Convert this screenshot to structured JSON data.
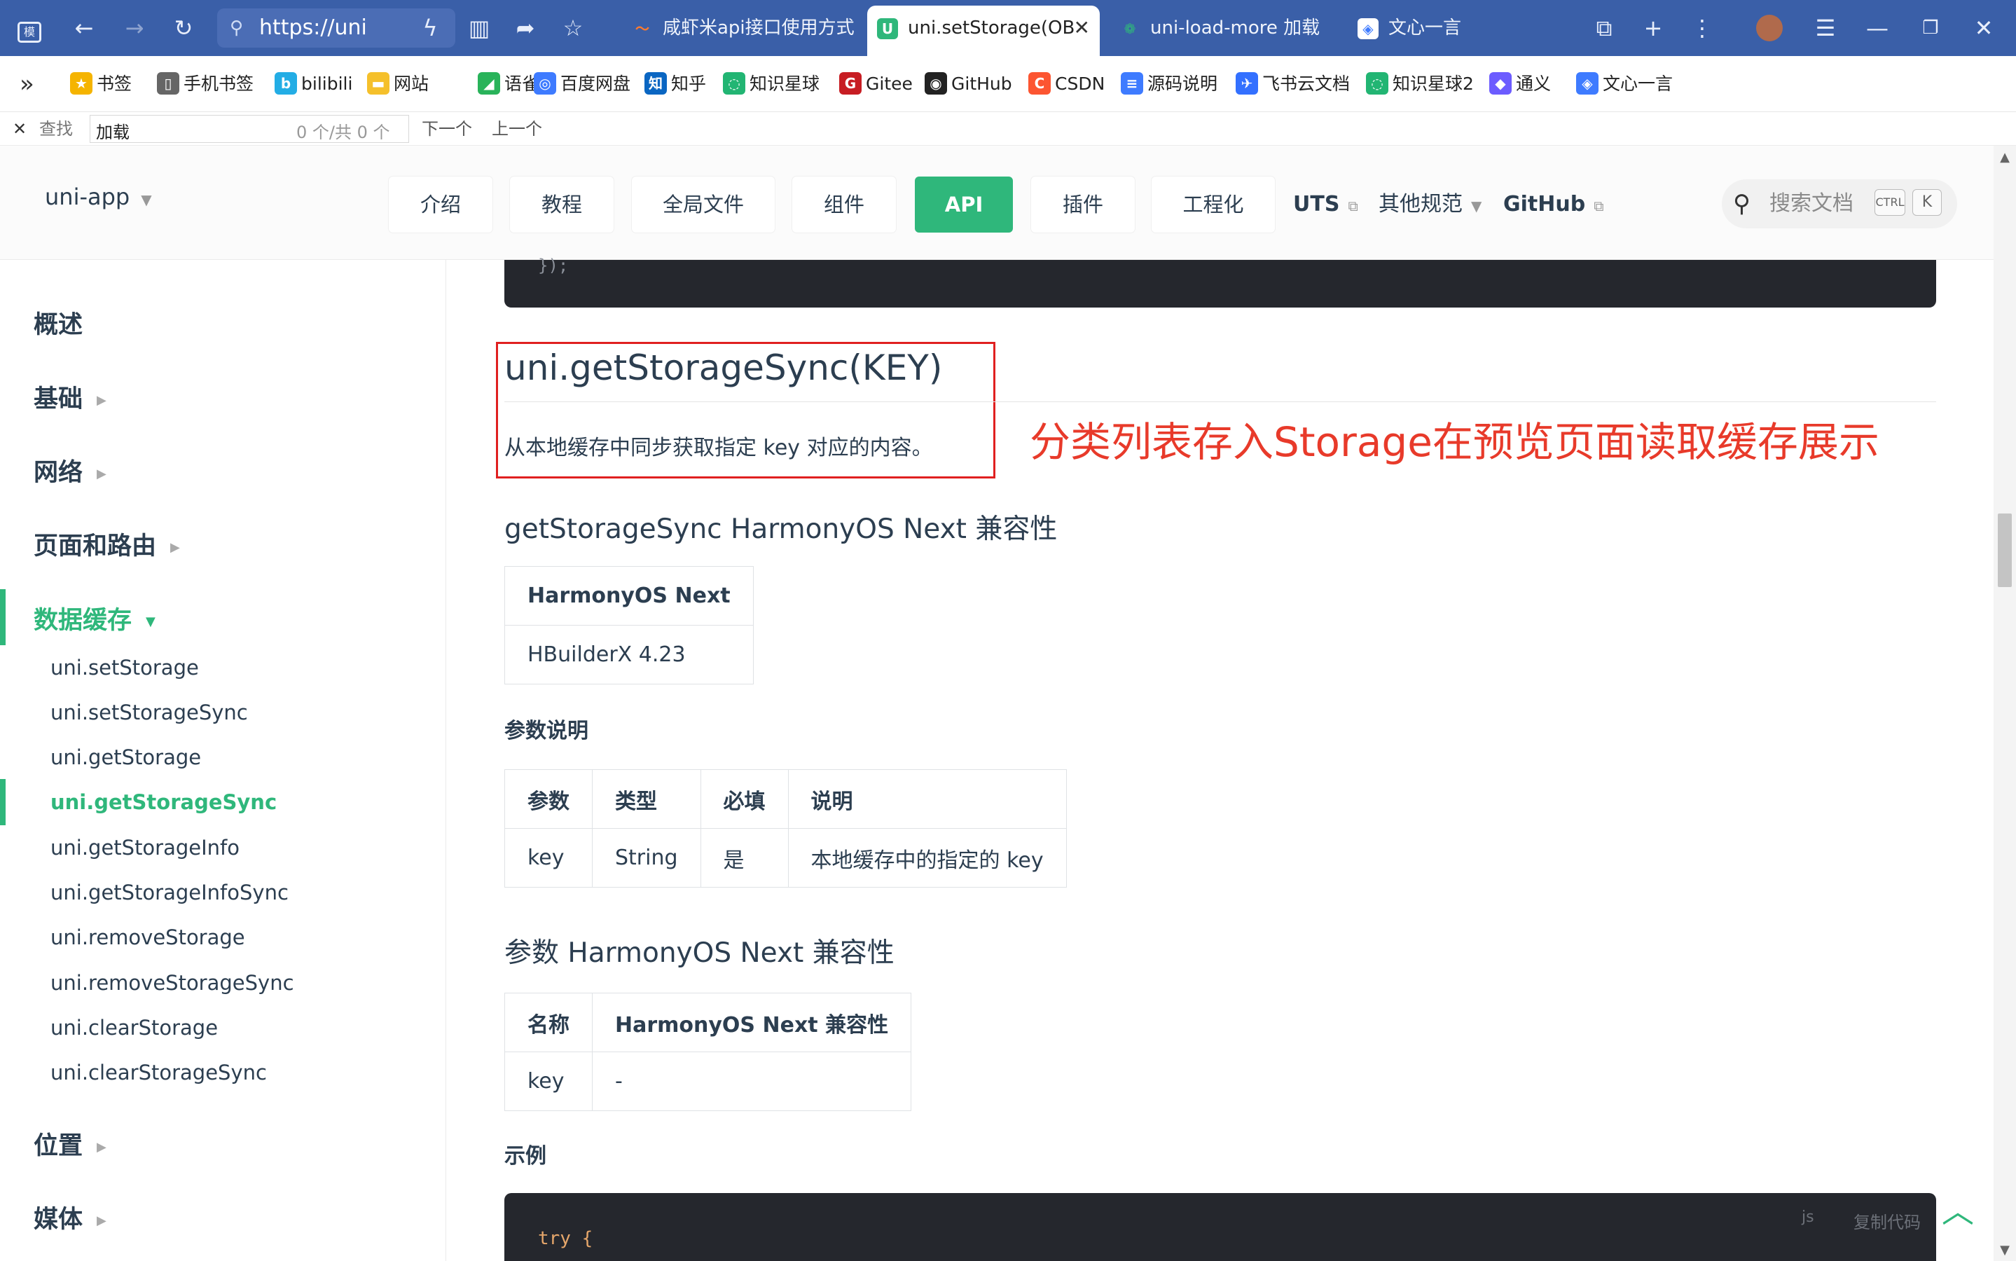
{
  "browser": {
    "address": "https://uni",
    "tabs": [
      {
        "label": "咸虾米api接口使用方式",
        "fav": "〜",
        "fav_color": "#ff7a2e"
      },
      {
        "label": "uni.setStorage(OB",
        "fav": "U",
        "fav_color": "#2fb77b"
      },
      {
        "label": "uni-load-more 加载",
        "fav": "❁",
        "fav_color": "#2fb77b"
      },
      {
        "label": "文心一言",
        "fav": "◈",
        "fav_color": "#3e7bff"
      }
    ],
    "bookmarks": [
      {
        "label": "书签",
        "icon": "★",
        "color": "#f5b400"
      },
      {
        "label": "手机书签",
        "icon": "▯",
        "color": "#666666"
      },
      {
        "label": "bilibili",
        "icon": "b",
        "color": "#23ade5"
      },
      {
        "label": "网站",
        "icon": "▬",
        "color": "#f5c02b"
      },
      {
        "label": "语雀",
        "icon": "◢",
        "color": "#29b35a"
      },
      {
        "label": "百度网盘",
        "icon": "◎",
        "color": "#3e7bff"
      },
      {
        "label": "知乎",
        "icon": "知",
        "color": "#0a66c2"
      },
      {
        "label": "知识星球",
        "icon": "◌",
        "color": "#22b573"
      },
      {
        "label": "Gitee",
        "icon": "G",
        "color": "#c71d23"
      },
      {
        "label": "GitHub",
        "icon": "◉",
        "color": "#222222"
      },
      {
        "label": "CSDN",
        "icon": "C",
        "color": "#fc5531"
      },
      {
        "label": "源码说明",
        "icon": "≡",
        "color": "#3e7bff"
      },
      {
        "label": "飞书云文档",
        "icon": "✈",
        "color": "#3370ff"
      },
      {
        "label": "知识星球2",
        "icon": "◌",
        "color": "#22b573"
      },
      {
        "label": "通义",
        "icon": "◆",
        "color": "#6c5cff"
      },
      {
        "label": "文心一言",
        "icon": "◈",
        "color": "#3e7bff"
      }
    ],
    "find": {
      "close": "✕",
      "label": "查找",
      "value": "加载",
      "count": "0 个/共 0 个",
      "next": "下一个",
      "prev": "上一个"
    }
  },
  "nav": {
    "logo": "uni-app",
    "buttons": [
      "介绍",
      "教程",
      "全局文件",
      "组件",
      "API",
      "插件",
      "工程化"
    ],
    "links": [
      "UTS",
      "其他规范",
      "GitHub"
    ],
    "search_placeholder": "搜索文档",
    "kbd_ctrl": "CTRL",
    "kbd_k": "K"
  },
  "sidebar": {
    "sections_top": [
      "概述",
      "基础",
      "网络",
      "页面和路由",
      "数据缓存"
    ],
    "items": [
      "uni.setStorage",
      "uni.setStorageSync",
      "uni.getStorage",
      "uni.getStorageSync",
      "uni.getStorageInfo",
      "uni.getStorageInfoSync",
      "uni.removeStorage",
      "uni.removeStorageSync",
      "uni.clearStorage",
      "uni.clearStorageSync"
    ],
    "sections_bottom": [
      "位置",
      "媒体"
    ]
  },
  "content": {
    "code_top": "});",
    "title": "uni.getStorageSync(KEY)",
    "description": "从本地缓存中同步获取指定 key 对应的内容。",
    "annotation": "分类列表存入Storage在预览页面读取缓存展示",
    "compat_heading": "getStorageSync HarmonyOS Next 兼容性",
    "compat_table": {
      "header": "HarmonyOS Next",
      "value": "HBuilderX 4.23"
    },
    "params_heading": "参数说明",
    "params_table": {
      "headers": [
        "参数",
        "类型",
        "必填",
        "说明"
      ],
      "row": [
        "key",
        "String",
        "是",
        "本地缓存中的指定的 key"
      ]
    },
    "param_compat_heading": "参数 HarmonyOS Next 兼容性",
    "param_compat_table": {
      "headers": [
        "名称",
        "HarmonyOS Next 兼容性"
      ],
      "row": [
        "key",
        "-"
      ]
    },
    "example_heading": "示例",
    "code_lang": "js",
    "code_copy": "复制代码",
    "code_first_line": "try {"
  }
}
